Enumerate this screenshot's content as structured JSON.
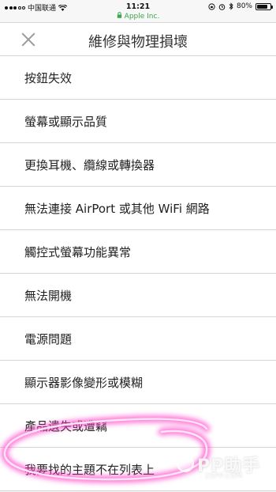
{
  "status_bar": {
    "carrier": "中国联通",
    "time": "11:21",
    "battery": "80%",
    "battery_level": 0.8
  },
  "url_bar": {
    "site": "Apple Inc."
  },
  "header": {
    "title": "維修與物理損壞"
  },
  "list": {
    "items": [
      {
        "label": "按鈕失效"
      },
      {
        "label": "螢幕或顯示品質"
      },
      {
        "label": "更換耳機、纜線或轉換器"
      },
      {
        "label": "無法連接 AirPort 或其他 WiFi 網路"
      },
      {
        "label": "觸控式螢幕功能異常"
      },
      {
        "label": "無法開機"
      },
      {
        "label": "電源問題"
      },
      {
        "label": "顯示器影像變形或模糊"
      },
      {
        "label": "產品遺失或遭竊"
      },
      {
        "label": "我要找的主題不在列表上"
      }
    ]
  },
  "watermark": {
    "brand": "PP助手",
    "site": "25PP.COM"
  },
  "colors": {
    "ssl_green": "#3aa64a",
    "highlight_pink": "#ff3cc8"
  }
}
